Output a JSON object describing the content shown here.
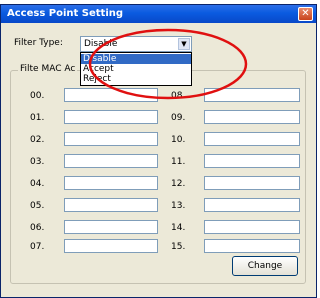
{
  "window": {
    "title": "Access Point Setting",
    "close_label": "✕"
  },
  "filter": {
    "label": "Filter Type:",
    "selected": "Disable",
    "arrow_glyph": "▼",
    "options": [
      "Disable",
      "Accept",
      "Reject"
    ]
  },
  "group": {
    "legend": "Filte MAC Ac"
  },
  "rows": {
    "left": [
      "00.",
      "01.",
      "02.",
      "03.",
      "04.",
      "05.",
      "06.",
      "07."
    ],
    "right": [
      "08.",
      "09.",
      "10.",
      "11.",
      "12.",
      "13.",
      "14.",
      "15."
    ]
  },
  "change_label": "Change",
  "colors": {
    "title_bar": "#0a5be0",
    "annotation": "#e01010",
    "selected_option": "#316ac5"
  }
}
